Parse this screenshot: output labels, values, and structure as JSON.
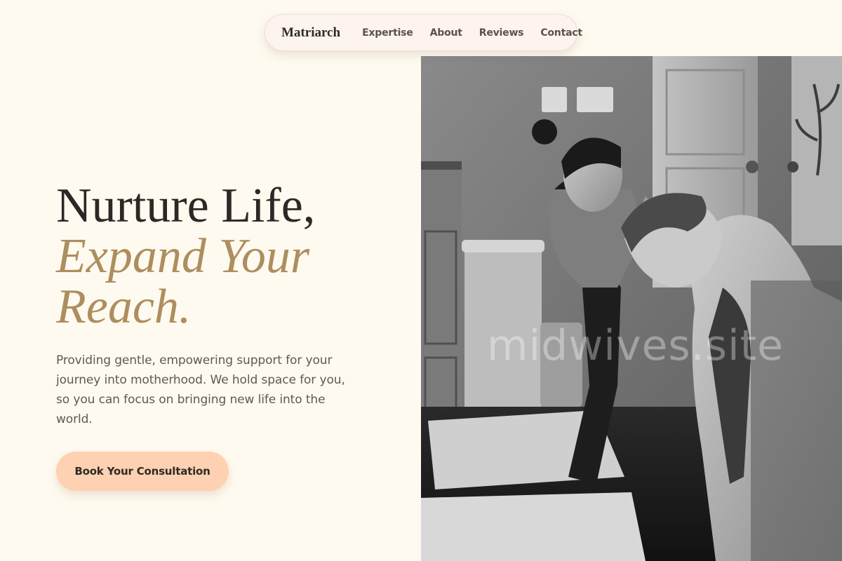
{
  "nav": {
    "brand": "Matriarch",
    "links": [
      "Expertise",
      "About",
      "Reviews",
      "Contact"
    ]
  },
  "hero": {
    "title_line1": "Nurture Life,",
    "title_accent": "Expand Your Reach.",
    "description": "Providing gentle, empowering support for your journey into motherhood. We hold space for you, so you can focus on bringing new life into the world.",
    "cta_label": "Book Your Consultation"
  },
  "image": {
    "watermark": "midwives.site"
  },
  "colors": {
    "background": "#fefaef",
    "accent": "#ad8e5f",
    "cta_background": "#fdd1b1",
    "nav_background": "#fdf4ef",
    "heading": "#2b2825"
  }
}
